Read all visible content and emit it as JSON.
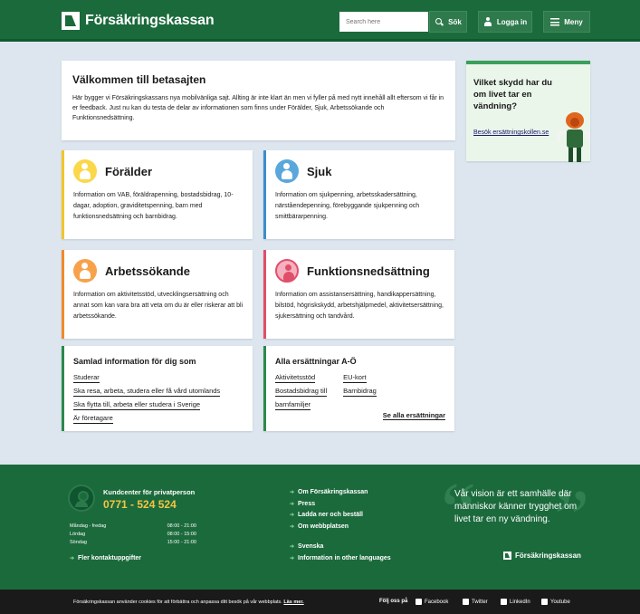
{
  "header": {
    "logo_text": "Försäkringskassan",
    "search_placeholder": "Search here",
    "search_label": "Sök",
    "login_label": "Logga in",
    "menu_label": "Meny"
  },
  "welcome": {
    "title": "Välkommen till betasajten",
    "text": "Här bygger vi Försäkringskassans nya mobilvänliga sajt. Allting är inte klart än men vi fyller på med nytt innehåll allt eftersom vi får in er feedback. Just nu kan du testa de delar av informationen som finns under Förälder, Sjuk, Arbetssökande och Funktionsnedsättning."
  },
  "promo": {
    "title": "Vilket skydd har du om livet tar en vändning?",
    "link": "Besök ersättningskollen.se"
  },
  "categories": [
    {
      "title": "Förälder",
      "text": "Information om VAB, föräldrapenning, bostadsbidrag, 10-dagar, adoption, graviditetspenning, barn med funktionsnedsättning och barnbidrag."
    },
    {
      "title": "Sjuk",
      "text": "Information om sjukpenning, arbetsskadersättning, närstående­penning, förebyggande sjukpenning och smittbärarpenning."
    },
    {
      "title": "Arbetssökande",
      "text": "Information om aktivitetsstöd, utvecklingsersättning och annat som kan vara bra att veta om du är eller riskerar att bli arbetssökande."
    },
    {
      "title": "Funktionsnedsättning",
      "text": "Information om assistansersättning, handikappersättning, bilstöd, högriskskydd, arbetshjälpmedel, aktivitetsersättning, sjukersättning och tandvård."
    }
  ],
  "samlad": {
    "title": "Samlad information för dig som",
    "links": [
      "Studerar",
      "Ska resa, arbeta, studera eller få vård utomlands",
      "Ska flytta till, arbeta eller studera i Sverige",
      "Är företagare"
    ]
  },
  "alla": {
    "title": "Alla ersättningar A-Ö",
    "col1": [
      "Aktivitetsstöd",
      "Bostadsbidrag till",
      "barnfamiljer"
    ],
    "col2": [
      "EU-kort",
      "Barnbidrag"
    ],
    "see_all": "Se alla ersättningar"
  },
  "footer": {
    "kc_title": "Kundcenter för privatperson",
    "phone": "0771 - 524 524",
    "hours": [
      {
        "day": "Måndag - fredag",
        "time": "08:00 - 21:00"
      },
      {
        "day": "Lördag",
        "time": "08:00 - 15:00"
      },
      {
        "day": "Söndag",
        "time": "15:00 - 21:00"
      }
    ],
    "more_contact": "Fler kontaktuppgifter",
    "links_a": [
      "Om Försäkringskassan",
      "Press",
      "Ladda ner och beställ",
      "Om webbplatsen"
    ],
    "links_b": [
      "Svenska",
      "Information in other languages"
    ],
    "vision": "Vår vision är ett samhälle där människor känner trygghet om livet tar en ny vändning.",
    "logo_text": "Försäkringskassan"
  },
  "bottom": {
    "cookie_text": "Försäkringskassan använder cookies för att förbättra och anpassa ditt besök på vår webbplats.",
    "cookie_link": "Läs mer.",
    "follow": "Följ oss på",
    "social": [
      "Facebook",
      "Twitter",
      "LinkedIn",
      "Youtube"
    ]
  },
  "colors": {
    "brand_green": "#1b6a3c",
    "accent_yellow": "#f2c52b",
    "accent_blue": "#3b8fcb",
    "accent_orange": "#f28a2d",
    "accent_pink": "#e04f6a"
  }
}
